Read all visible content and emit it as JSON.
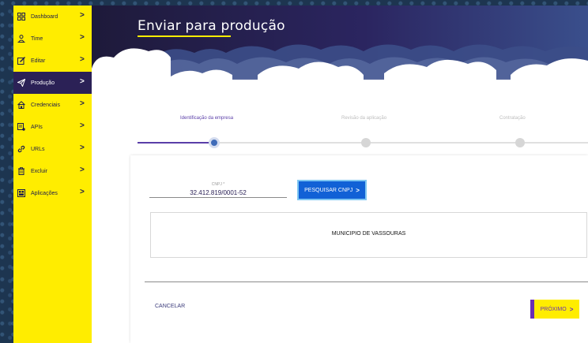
{
  "sidebar": {
    "items": [
      {
        "label": "Dashboard",
        "icon": "grid-icon",
        "active": false
      },
      {
        "label": "Time",
        "icon": "person-icon",
        "active": false
      },
      {
        "label": "Editar",
        "icon": "edit-icon",
        "active": false
      },
      {
        "label": "Produção",
        "icon": "send-icon",
        "active": true
      },
      {
        "label": "Credenciais",
        "icon": "house-icon",
        "active": false
      },
      {
        "label": "APIs",
        "icon": "api-icon",
        "active": false
      },
      {
        "label": "URLs",
        "icon": "link-icon",
        "active": false
      },
      {
        "label": "Excluir",
        "icon": "trash-icon",
        "active": false
      },
      {
        "label": "Aplicações",
        "icon": "app-icon",
        "active": false
      }
    ],
    "chevron": ">"
  },
  "header": {
    "title": "Enviar para produção"
  },
  "stepper": {
    "steps": [
      {
        "label": "Identificação da empresa",
        "state": "active"
      },
      {
        "label": "Revisão da aplicação",
        "state": "pending"
      },
      {
        "label": "Contratação",
        "state": "pending"
      }
    ]
  },
  "form": {
    "cnpj_label": "CNPJ *",
    "cnpj_value": "32.412.819/0001-52",
    "search_button": "PESQUISAR CNPJ",
    "search_chevron": ">",
    "result_name": "MUNICIPIO DE VASSOURAS"
  },
  "footer": {
    "cancel_label": "CANCELAR",
    "next_label": "PRÓXIMO",
    "next_chevron": ">"
  },
  "colors": {
    "sidebar_bg": "#ffed00",
    "sidebar_active": "#2b2156",
    "accent_purple": "#6a2fb5",
    "button_blue": "#1161d6"
  }
}
